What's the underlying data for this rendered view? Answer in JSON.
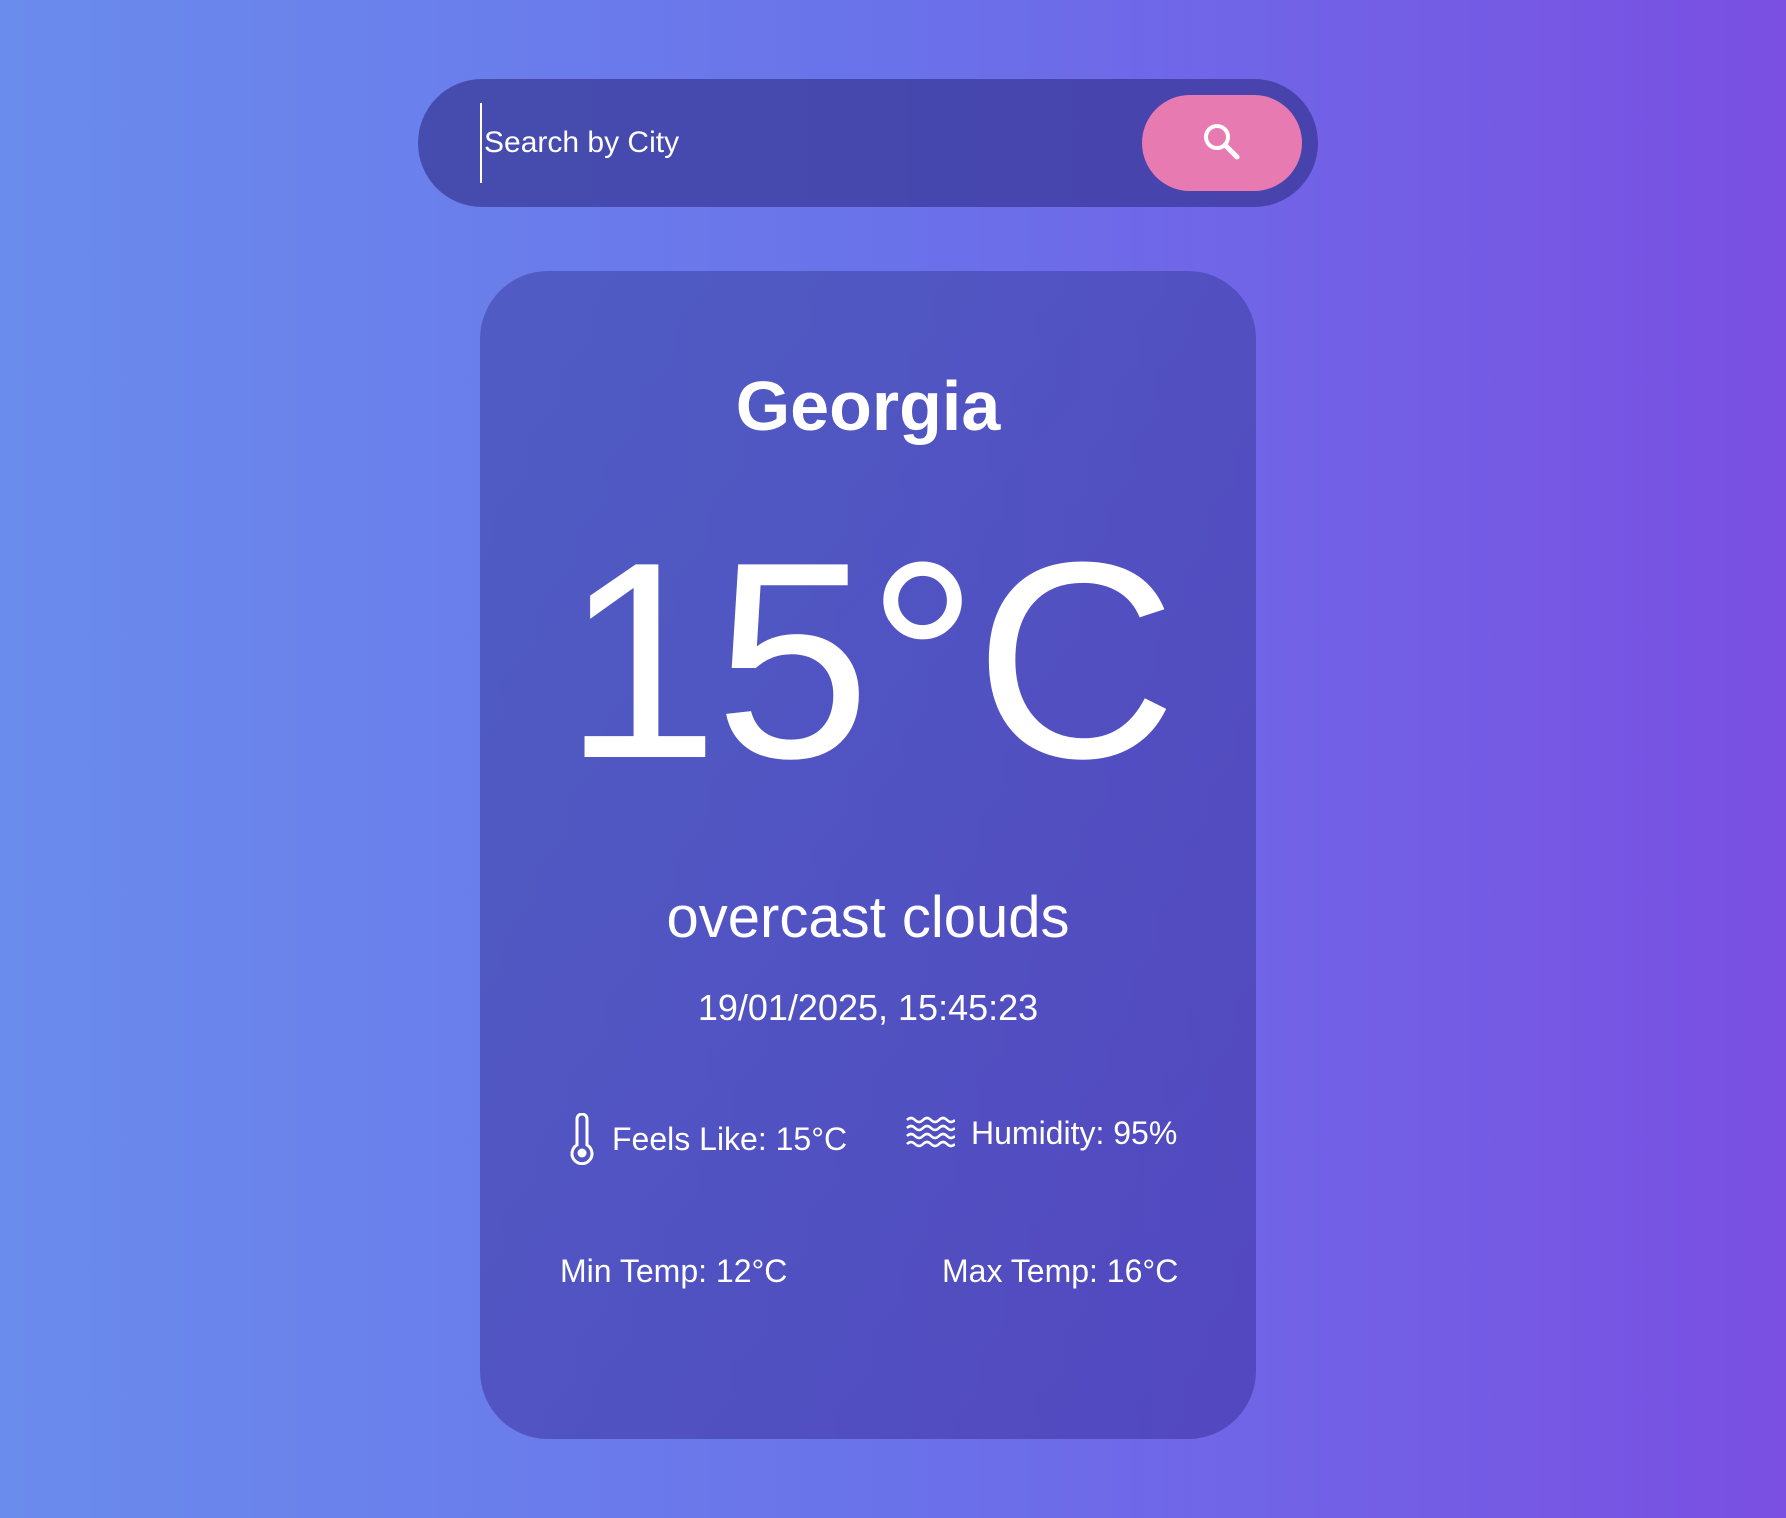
{
  "search": {
    "placeholder": "Search by City",
    "button_icon": "search-icon"
  },
  "weather": {
    "city": "Georgia",
    "temperature": "15°C",
    "description": "overcast clouds",
    "datetime": "19/01/2025, 15:45:23",
    "feels_like": "Feels Like: 15°C",
    "humidity": "Humidity: 95%",
    "min_temp": "Min Temp: 12°C",
    "max_temp": "Max Temp: 16°C"
  },
  "icons": {
    "feels_like": "thermometer-icon",
    "humidity": "humidity-waves-icon"
  },
  "colors": {
    "search_button": "#e87ab2",
    "background_start": "#6a8ced",
    "background_end": "#7a4fe2"
  }
}
